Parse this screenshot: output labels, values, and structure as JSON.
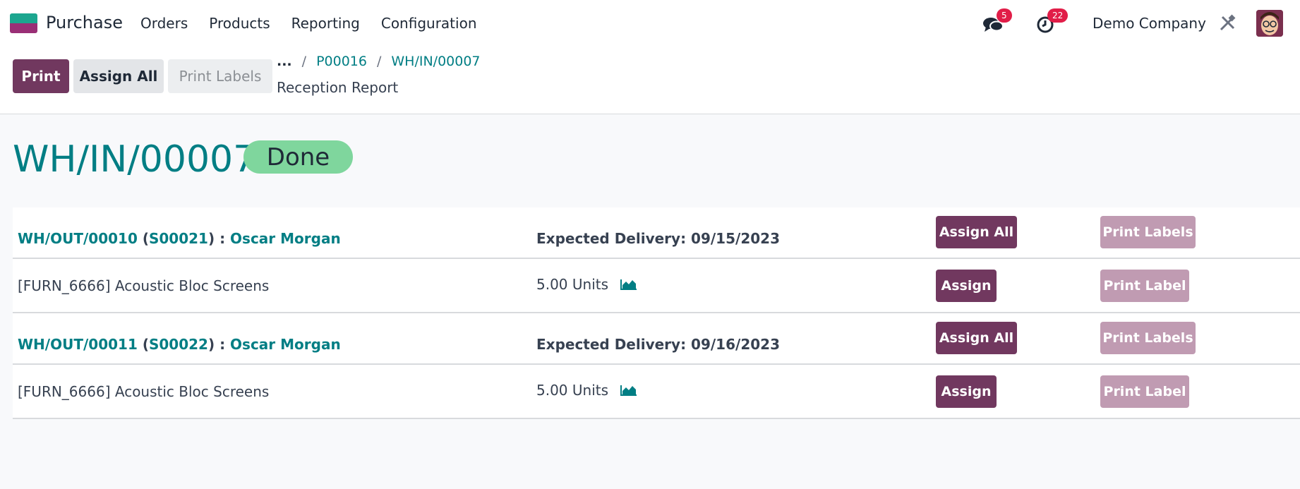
{
  "app": {
    "name": "Purchase"
  },
  "menu": [
    "Orders",
    "Products",
    "Reporting",
    "Configuration"
  ],
  "systray": {
    "messages_count": "5",
    "activity_count": "22",
    "company": "Demo Company"
  },
  "toolbar": {
    "print": "Print",
    "assign_all": "Assign All",
    "print_labels": "Print Labels"
  },
  "breadcrumb": {
    "more": "...",
    "po": "P00016",
    "receipt": "WH/IN/00007",
    "current": "Reception Report"
  },
  "page": {
    "title": "WH/IN/00007",
    "status": "Done"
  },
  "groups": [
    {
      "out_ref": "WH/OUT/00010",
      "so_ref": "S00021",
      "partner": "Oscar Morgan",
      "open_paren": "(",
      "close_paren": ") : ",
      "delivery": "Expected Delivery: 09/15/2023",
      "assign_all": "Assign All",
      "print_labels": "Print Labels",
      "line": {
        "product": "[FURN_6666] Acoustic Bloc Screens",
        "qty": "5.00 Units",
        "assign": "Assign",
        "print_label": "Print Label"
      }
    },
    {
      "out_ref": "WH/OUT/00011",
      "so_ref": "S00022",
      "partner": "Oscar Morgan",
      "open_paren": "(",
      "close_paren": ") : ",
      "delivery": "Expected Delivery: 09/16/2023",
      "assign_all": "Assign All",
      "print_labels": "Print Labels",
      "line": {
        "product": "[FURN_6666] Acoustic Bloc Screens",
        "qty": "5.00 Units",
        "assign": "Assign",
        "print_label": "Print Label"
      }
    }
  ],
  "colors": {
    "primary": "#71385f",
    "link": "#017e84",
    "done": "#7fd69d",
    "badge": "#e11d48"
  }
}
